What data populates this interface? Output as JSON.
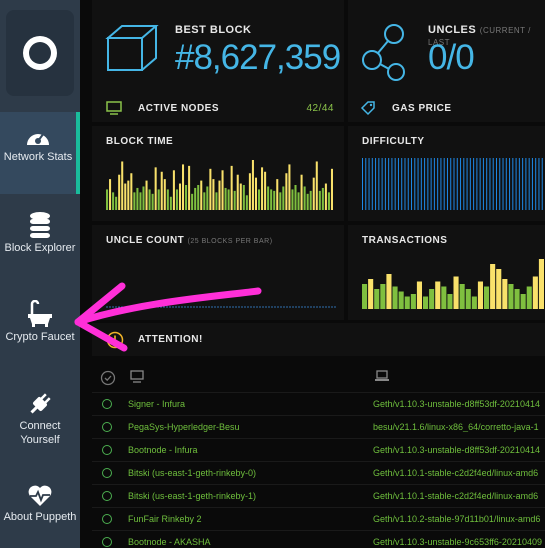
{
  "sidebar": {
    "items": [
      {
        "label": "Network Stats",
        "icon": "gauge-icon"
      },
      {
        "label": "Block Explorer",
        "icon": "database-icon"
      },
      {
        "label": "Crypto Faucet",
        "icon": "bathtub-icon"
      },
      {
        "label": "Connect Yourself",
        "icon": "plug-icon"
      },
      {
        "label": "About Puppeth",
        "icon": "heartbeat-icon"
      }
    ]
  },
  "stats": {
    "best_block": {
      "title": "BEST BLOCK",
      "value": "#8,627,359"
    },
    "uncles": {
      "title": "UNCLES",
      "subtitle": "(CURRENT / LAST",
      "value": "0/0"
    },
    "active_nodes": {
      "title": "ACTIVE NODES",
      "value": "42/44"
    },
    "gas_price": {
      "title": "GAS PRICE"
    }
  },
  "panels": {
    "block_time": "BLOCK TIME",
    "difficulty": "DIFFICULTY",
    "uncle_count": "UNCLE COUNT",
    "uncle_count_sub": "(25 BLOCKS PER BAR)",
    "transactions": "TRANSACTIONS"
  },
  "attention": "ATTENTION!",
  "nodes": [
    {
      "name": "Signer - Infura",
      "client": "Geth/v1.10.3-unstable-d8ff53df-20210414"
    },
    {
      "name": "PegaSys-Hyperledger-Besu",
      "client": "besu/v21.1.6/linux-x86_64/corretto-java-1"
    },
    {
      "name": "Bootnode - Infura",
      "client": "Geth/v1.10.3-unstable-d8ff53df-20210414"
    },
    {
      "name": "Bitski (us-east-1-geth-rinkeby-0)",
      "client": "Geth/v1.10.1-stable-c2d2f4ed/linux-amd6"
    },
    {
      "name": "Bitski (us-east-1-geth-rinkeby-1)",
      "client": "Geth/v1.10.1-stable-c2d2f4ed/linux-amd6"
    },
    {
      "name": "FunFair Rinkeby 2",
      "client": "Geth/v1.10.2-stable-97d11b01/linux-amd6"
    },
    {
      "name": "Bootnode - AKASHA",
      "client": "Geth/v1.10.3-unstable-9c653ff6-20210409"
    }
  ],
  "chart_data": [
    {
      "type": "bar",
      "title": "BLOCK TIME",
      "values": [
        14,
        21,
        12,
        9,
        24,
        33,
        18,
        20,
        25,
        12,
        15,
        12,
        16,
        20,
        14,
        11,
        29,
        14,
        26,
        21,
        14,
        9,
        27,
        14,
        18,
        31,
        17,
        30,
        11,
        15,
        17,
        20,
        12,
        16,
        28,
        21,
        12,
        20,
        27,
        15,
        14,
        30,
        13,
        24,
        18,
        17,
        10,
        25,
        34,
        22,
        14,
        29,
        26,
        16,
        14,
        13,
        21,
        12,
        16,
        25,
        31,
        14,
        17,
        12,
        24,
        16,
        11,
        13,
        22,
        33,
        13,
        15,
        18,
        12,
        28
      ],
      "bar_colors": [
        "#f9e16b",
        "#7fbf3f"
      ]
    },
    {
      "type": "bar",
      "title": "DIFFICULTY",
      "values": [
        1,
        1,
        1,
        1,
        1,
        1,
        1,
        1,
        1,
        1,
        1,
        1,
        1,
        1,
        1,
        1,
        1,
        1,
        1,
        1,
        1,
        1,
        1,
        1,
        1,
        1,
        1,
        1,
        1,
        1,
        1,
        1,
        1,
        1,
        1,
        1,
        1,
        1,
        1,
        1,
        1,
        1,
        1,
        1,
        1,
        1,
        1,
        1,
        1,
        1,
        1,
        1,
        1,
        1,
        1,
        1
      ],
      "bar_color": "#1e88e5"
    },
    {
      "type": "bar",
      "title": "TRANSACTIONS",
      "values": [
        10,
        12,
        8,
        10,
        14,
        9,
        7,
        5,
        6,
        11,
        5,
        8,
        11,
        9,
        6,
        13,
        10,
        8,
        5,
        11,
        9,
        18,
        16,
        12,
        10,
        8,
        6,
        9,
        13,
        20
      ],
      "bar_colors": [
        "#f9e16b",
        "#7fbf3f"
      ]
    }
  ]
}
